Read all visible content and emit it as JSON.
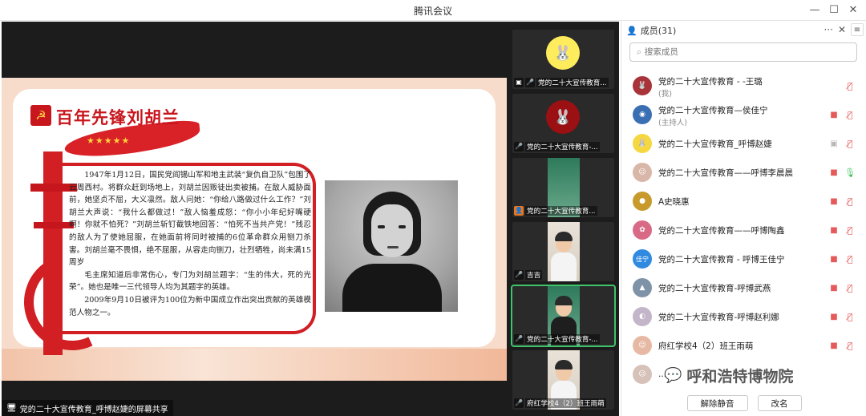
{
  "window": {
    "title": "腾讯会议",
    "controls": {
      "minimize": "—",
      "maximize": "☐",
      "close": "✕"
    }
  },
  "share": {
    "slide_title": "百年先锋刘胡兰",
    "paragraphs": [
      "1947年1月12日，国民党阎锡山军和地主武装“复仇自卫队”包围了云周西村。将群众赶到场地上，刘胡兰因叛徒出卖被捕。在敌人威胁面前，她坚贞不屈，大义凛然。敌人问她：“你给八路做过什么工作？”刘胡兰大声说：“我什么都做过！”敌人恼羞成怒：“你小小年纪好嘴硬啊！你就不怕死？”刘胡兰斩钉截铁地回答：“怕死不当共产党！”残忍的敌人为了使她屈服，在她面前将同时被捕的6位革命群众用铡刀杀害。刘胡兰毫不畏惧，绝不屈服，从容走向铡刀，壮烈牺牲，尚未满15周岁",
      "毛主席知道后非常伤心，专门为刘胡兰题字：“生的伟大，死的光荣”。她也是唯一三代领导人均为其题字的英雄。",
      "2009年9月10日被评为100位为新中国成立作出突出贡献的英雄模范人物之一。"
    ],
    "stars": "★★★★★",
    "caption": "党的二十大宣传教育_呼博赵婕的屏幕共享"
  },
  "video_tiles": [
    {
      "label": "党的二十大宣传教育...",
      "kind": "avatar-yellow",
      "glyph": "🐰",
      "label_icon": "🎤"
    },
    {
      "label": "党的二十大宣传教育-...",
      "kind": "avatar-red",
      "glyph": "🐰",
      "label_icon": "🎤"
    },
    {
      "label": "党的二十大宣传教育...",
      "kind": "video-green",
      "glyph": "",
      "label_icon": "👤"
    },
    {
      "label": "吉吉",
      "kind": "video-person",
      "glyph": "",
      "label_icon": "🎤"
    },
    {
      "label": "党的二十大宣传教育-...",
      "kind": "video-green-person",
      "glyph": "",
      "label_icon": "🎤"
    },
    {
      "label": "府红学校4（2）班王雨萌",
      "kind": "video-person",
      "glyph": "",
      "label_icon": "🎤"
    }
  ],
  "members_panel": {
    "title": "成员(31)",
    "search_placeholder": "搜索成员",
    "members": [
      {
        "name": "党的二十大宣传教育 - -王璐",
        "role": "(我)",
        "avatar_color": "#a8343a",
        "avatar_glyph": "🐰",
        "mic": "muted",
        "cam": "none"
      },
      {
        "name": "党的二十大宣传教育—侯佳宁",
        "role": "(主持人)",
        "avatar_color": "#3b6fb3",
        "avatar_glyph": "◉",
        "mic": "muted",
        "cam": "off"
      },
      {
        "name": "党的二十大宣传教育_呼博赵婕",
        "role": "",
        "avatar_color": "#f5d742",
        "avatar_glyph": "🐰",
        "mic": "muted",
        "cam": "share"
      },
      {
        "name": "党的二十大宣传教育——呼博李晨晨",
        "role": "",
        "avatar_color": "#d9b7a8",
        "avatar_glyph": "☺",
        "mic": "on",
        "cam": "off"
      },
      {
        "name": "A史晓惠",
        "role": "",
        "avatar_color": "#c79a2b",
        "avatar_glyph": "●",
        "mic": "muted",
        "cam": "off"
      },
      {
        "name": "党的二十大宣传教育——呼博陶鑫",
        "role": "",
        "avatar_color": "#d86a86",
        "avatar_glyph": "✿",
        "mic": "muted",
        "cam": "off"
      },
      {
        "name": "党的二十大宣传教育 - 呼博王佳宁",
        "role": "",
        "avatar_color": "#2f8ae0",
        "avatar_glyph": "佳宁",
        "mic": "muted",
        "cam": "off"
      },
      {
        "name": "党的二十大宣传教育-呼博武燕",
        "role": "",
        "avatar_color": "#7f93a8",
        "avatar_glyph": "▲",
        "mic": "muted",
        "cam": "off"
      },
      {
        "name": "党的二十大宣传教育-呼博赵利娜",
        "role": "",
        "avatar_color": "#c4b6c9",
        "avatar_glyph": "◐",
        "mic": "muted",
        "cam": "off"
      },
      {
        "name": "府红学校4（2）班王雨萌",
        "role": "",
        "avatar_color": "#e7b9a4",
        "avatar_glyph": "☺",
        "mic": "muted",
        "cam": "off"
      },
      {
        "name": "...",
        "role": "",
        "avatar_color": "#d6c2b8",
        "avatar_glyph": "☺",
        "mic": "muted",
        "cam": "off"
      }
    ],
    "unmute_all": "解除静音",
    "rename": "改名"
  },
  "watermark": "呼和浩特博物院"
}
